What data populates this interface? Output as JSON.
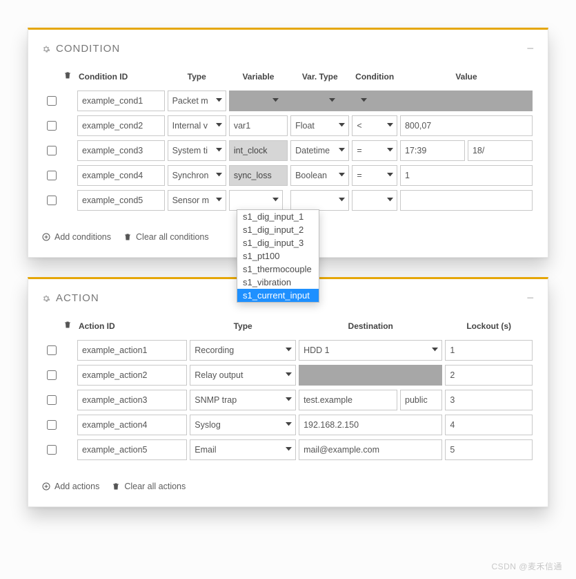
{
  "condition_panel": {
    "title": "CONDITION",
    "headers": {
      "id": "Condition ID",
      "type": "Type",
      "variable": "Variable",
      "vartype": "Var. Type",
      "condition": "Condition",
      "value": "Value"
    },
    "rows": [
      {
        "id": "example_cond1",
        "type": "Packet m",
        "variable_disabled": true
      },
      {
        "id": "example_cond2",
        "type": "Internal v",
        "variable": "var1",
        "vartype": "Float",
        "condition": "<",
        "value": "800,07"
      },
      {
        "id": "example_cond3",
        "type": "System ti",
        "variable": "int_clock",
        "variable_ro": true,
        "vartype": "Datetime",
        "condition": "=",
        "value": "17:39",
        "value2": "18/"
      },
      {
        "id": "example_cond4",
        "type": "Synchron",
        "variable": "sync_loss",
        "variable_ro": true,
        "vartype": "Boolean",
        "condition": "=",
        "value": "1"
      },
      {
        "id": "example_cond5",
        "type": "Sensor m",
        "variable_dropdown_open": true
      }
    ],
    "dropdown_options": [
      "s1_dig_input_1",
      "s1_dig_input_2",
      "s1_dig_input_3",
      "s1_pt100",
      "s1_thermocouple",
      "s1_vibration",
      "s1_current_input"
    ],
    "dropdown_selected_index": 6,
    "add_label": "Add conditions",
    "clear_label": "Clear all conditions"
  },
  "action_panel": {
    "title": "ACTION",
    "headers": {
      "id": "Action ID",
      "type": "Type",
      "destination": "Destination",
      "lockout": "Lockout (s)"
    },
    "rows": [
      {
        "id": "example_action1",
        "type": "Recording",
        "destination": "HDD 1",
        "dest_is_select": true,
        "lockout": "1"
      },
      {
        "id": "example_action2",
        "type": "Relay output",
        "destination_disabled": true,
        "lockout": "2"
      },
      {
        "id": "example_action3",
        "type": "SNMP trap",
        "destination": "test.example",
        "destination2": "public",
        "lockout": "3"
      },
      {
        "id": "example_action4",
        "type": "Syslog",
        "destination": "192.168.2.150",
        "lockout": "4"
      },
      {
        "id": "example_action5",
        "type": "Email",
        "destination": "mail@example.com",
        "lockout": "5"
      }
    ],
    "add_label": "Add actions",
    "clear_label": "Clear all actions"
  },
  "watermark": "CSDN @麦禾信通"
}
